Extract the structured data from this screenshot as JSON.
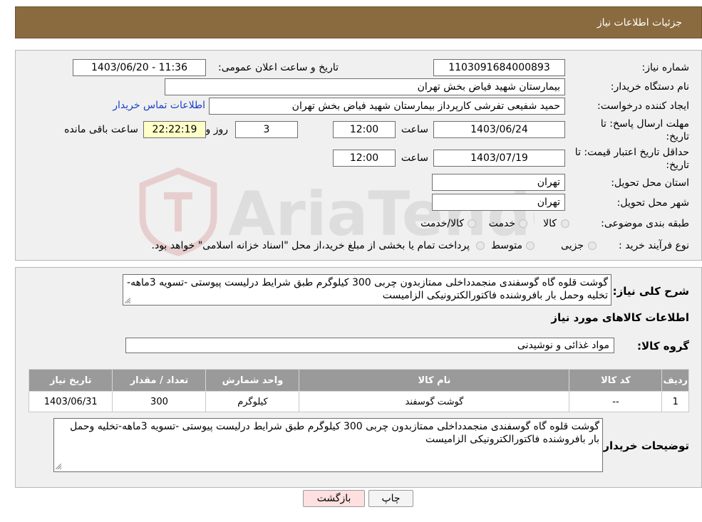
{
  "header": {
    "title": "جزئیات اطلاعات نیاز"
  },
  "form": {
    "need_number_label": "شماره نیاز:",
    "need_number": "1103091684000893",
    "announce_label": "تاریخ و ساعت اعلان عمومی:",
    "announce_value": "1403/06/20 - 11:36",
    "buyer_org_label": "نام دستگاه خریدار:",
    "buyer_org": "بیمارستان شهید فیاض بخش تهران",
    "creator_label": "ایجاد کننده درخواست:",
    "creator": "حمید شفیعی تفرشی کارپرداز بیمارستان شهید فیاض بخش تهران",
    "contact_link": "اطلاعات تماس خریدار",
    "deadline_label_1": "مهلت ارسال پاسخ: تا",
    "deadline_label_2": "تاریخ:",
    "deadline_date": "1403/06/24",
    "time_word": "ساعت",
    "deadline_time": "12:00",
    "days_value": "3",
    "days_word": "روز و",
    "remaining_time": "22:22:19",
    "remaining_word": "ساعت باقی مانده",
    "validity_label_1": "حداقل تاریخ اعتبار قیمت: تا",
    "validity_label_2": "تاریخ:",
    "validity_date": "1403/07/19",
    "validity_time": "12:00",
    "province_label": "استان محل تحویل:",
    "province": "تهران",
    "city_label": "شهر محل تحویل:",
    "city": "تهران",
    "category_label": "طبقه بندی موضوعی:",
    "category_options": [
      "کالا",
      "خدمت",
      "کالا/خدمت"
    ],
    "process_label": "نوع فرآیند خرید :",
    "process_options": [
      "جزیی",
      "متوسط"
    ],
    "process_note": "پرداخت تمام یا بخشی از مبلغ خرید،از محل \"اسناد خزانه اسلامی\" خواهد بود."
  },
  "description": {
    "label": "شرح کلی نیاز:",
    "text": "گوشت قلوه گاه گوسفندی منجمدداخلی ممتازبدون چربی  300 کیلوگرم طبق شرایط درلیست پیوستی -تسویه 3ماهه-تخلیه وحمل بار بافروشنده فاکتورالکترونیکی الزامیست"
  },
  "goods": {
    "section_title": "اطلاعات کالاهای مورد نیاز",
    "group_label": "گروه کالا:",
    "group_value": "مواد غذائی و نوشیدنی",
    "columns": [
      "ردیف",
      "کد کالا",
      "نام کالا",
      "واحد شمارش",
      "تعداد / مقدار",
      "تاریخ نیاز"
    ],
    "rows": [
      [
        "1",
        "--",
        "گوشت گوسفند",
        "کیلوگرم",
        "300",
        "1403/06/31"
      ]
    ]
  },
  "buyer_notes": {
    "label": "توضیحات خریدار:",
    "text": "گوشت قلوه گاه گوسفندی منجمدداخلی ممتازبدون چربی  300 کیلوگرم طبق شرایط درلیست پیوستی -تسویه 3ماهه-تخلیه وحمل بار بافروشنده فاکتورالکترونیکی الزامیست"
  },
  "buttons": {
    "print": "چاپ",
    "back": "بازگشت"
  },
  "colors": {
    "header": "#8a6b3f",
    "panel": "#f0f0f0",
    "link": "#1a3fc8",
    "back_button": "#ffe0e0",
    "remaining_field": "#ffffc8"
  }
}
